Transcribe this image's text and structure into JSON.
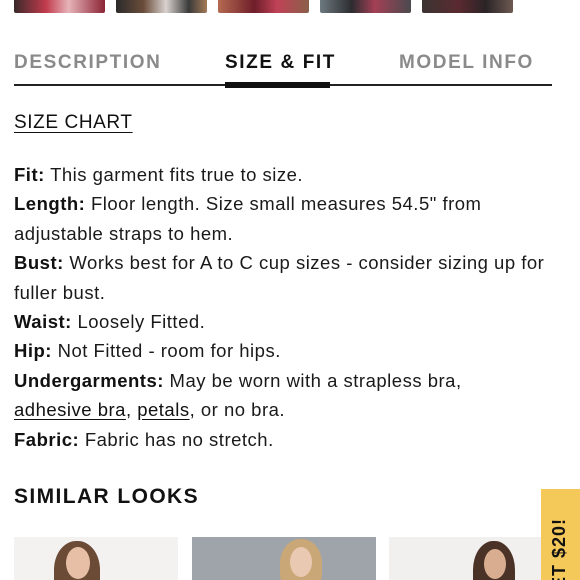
{
  "thumbnails": [
    {
      "label": "thumbnail-1"
    },
    {
      "label": "thumbnail-2"
    },
    {
      "label": "thumbnail-3"
    },
    {
      "label": "thumbnail-4"
    },
    {
      "label": "thumbnail-5"
    }
  ],
  "tabs": {
    "description": "DESCRIPTION",
    "size_fit": "SIZE & FIT",
    "model_info": "MODEL INFO",
    "active": "SIZE & FIT"
  },
  "size_chart_link": "SIZE CHART",
  "details": {
    "fit": {
      "label": "Fit:",
      "text": " This garment fits true to size."
    },
    "length": {
      "label": "Length:",
      "text": " Floor length. Size small measures 54.5\" from adjustable straps to hem."
    },
    "bust": {
      "label": "Bust:",
      "text": " Works best for A to C cup sizes - consider sizing up for fuller bust."
    },
    "waist": {
      "label": "Waist:",
      "text": " Loosely Fitted."
    },
    "hip": {
      "label": "Hip:",
      "text": " Not Fitted - room for hips."
    },
    "undergarments": {
      "label": "Undergarments:",
      "text_before": " May be worn with a strapless bra, ",
      "link1": "adhesive bra",
      "sep": ", ",
      "link2": "petals",
      "text_after": ", or no bra."
    },
    "fabric": {
      "label": "Fabric:",
      "text": " Fabric has no stretch."
    }
  },
  "similar_looks": {
    "title": "SIMILAR LOOKS"
  },
  "promo": {
    "text": "ET $20!",
    "color": "#f5c85a"
  },
  "colors": {
    "active_tab": "#111111",
    "inactive_tab": "#8a8a8a"
  }
}
